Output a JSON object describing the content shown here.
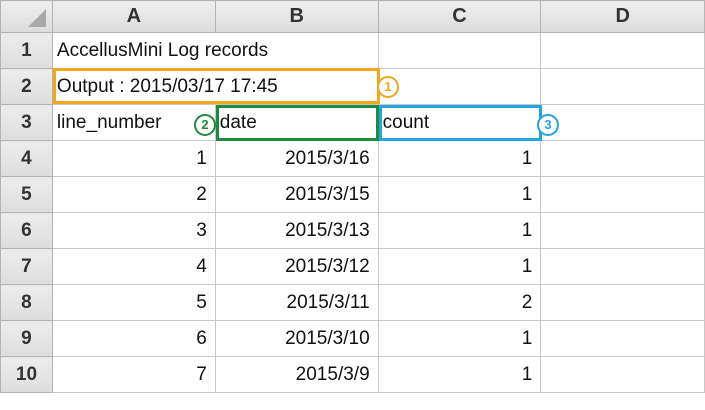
{
  "columns": [
    "A",
    "B",
    "C",
    "D"
  ],
  "rows": [
    {
      "n": "1",
      "a": "AccellusMini Log records",
      "b": "",
      "c": ""
    },
    {
      "n": "2",
      "a": "Output : 2015/03/17 17:45",
      "b": "",
      "c": ""
    },
    {
      "n": "3",
      "a": "line_number",
      "b": "date",
      "c": "count"
    },
    {
      "n": "4",
      "a": "1",
      "b": "2015/3/16",
      "c": "1"
    },
    {
      "n": "5",
      "a": "2",
      "b": "2015/3/15",
      "c": "1"
    },
    {
      "n": "6",
      "a": "3",
      "b": "2015/3/13",
      "c": "1"
    },
    {
      "n": "7",
      "a": "4",
      "b": "2015/3/12",
      "c": "1"
    },
    {
      "n": "8",
      "a": "5",
      "b": "2015/3/11",
      "c": "2"
    },
    {
      "n": "9",
      "a": "6",
      "b": "2015/3/10",
      "c": "1"
    },
    {
      "n": "10",
      "a": "7",
      "b": "2015/3/9",
      "c": "1"
    }
  ],
  "callouts": {
    "one": "1",
    "two": "2",
    "three": "3"
  },
  "colors": {
    "callout_output": "#f0a81c",
    "callout_date": "#1f8a3c",
    "callout_count": "#25a4de",
    "header_bg": "#e3e3e3",
    "grid_line": "#c8c8c8"
  }
}
